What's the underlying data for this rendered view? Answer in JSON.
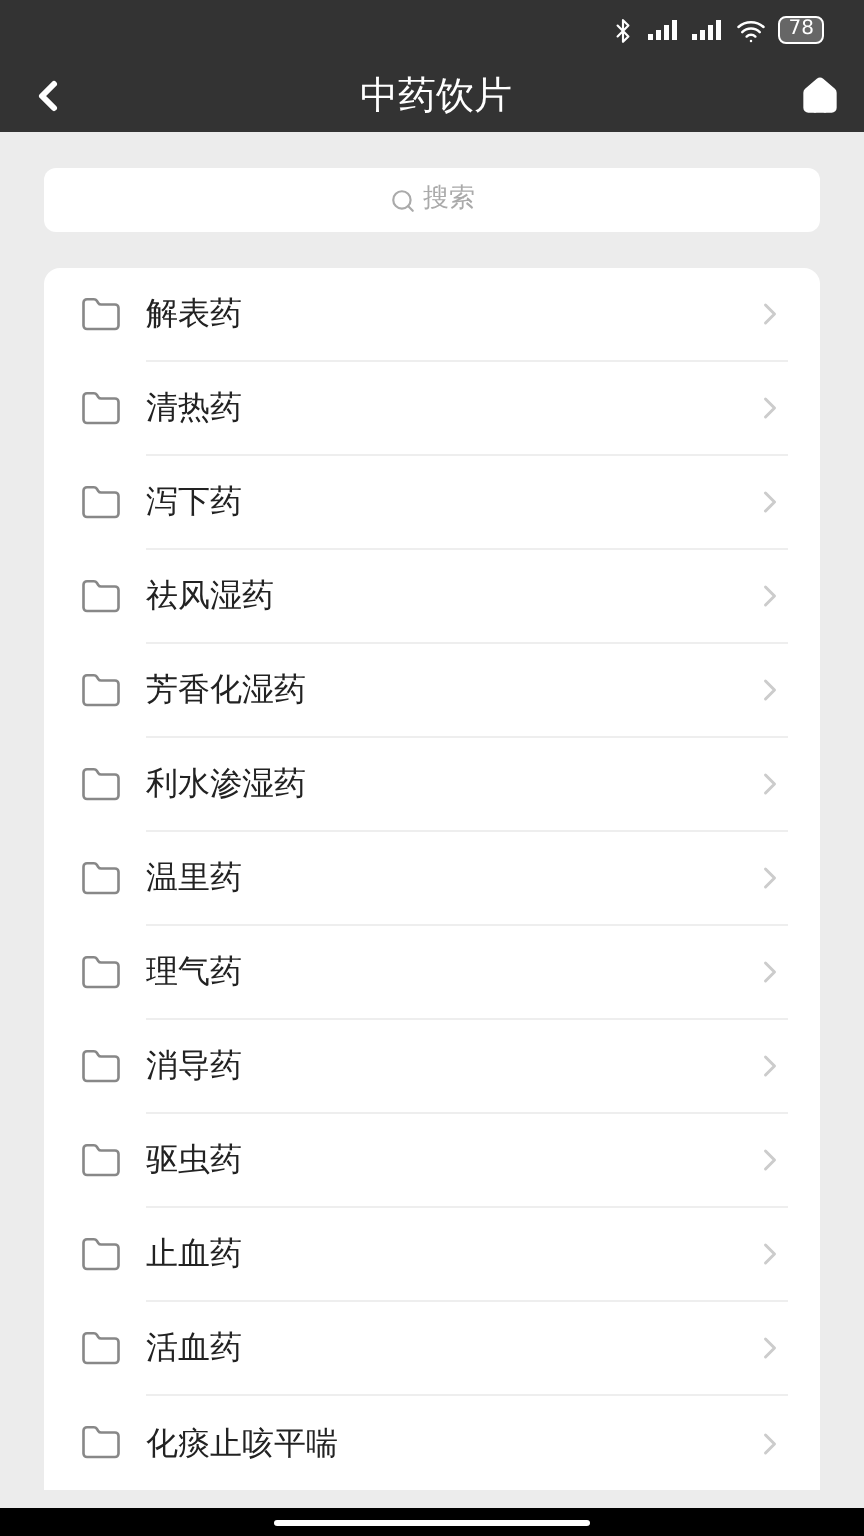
{
  "status_bar": {
    "battery": "78"
  },
  "header": {
    "title": "中药饮片"
  },
  "search": {
    "placeholder": "搜索"
  },
  "categories": [
    {
      "label": "解表药"
    },
    {
      "label": "清热药"
    },
    {
      "label": "泻下药"
    },
    {
      "label": "祛风湿药"
    },
    {
      "label": "芳香化湿药"
    },
    {
      "label": "利水渗湿药"
    },
    {
      "label": "温里药"
    },
    {
      "label": "理气药"
    },
    {
      "label": "消导药"
    },
    {
      "label": "驱虫药"
    },
    {
      "label": "止血药"
    },
    {
      "label": "活血药"
    },
    {
      "label": "化痰止咳平喘"
    }
  ]
}
